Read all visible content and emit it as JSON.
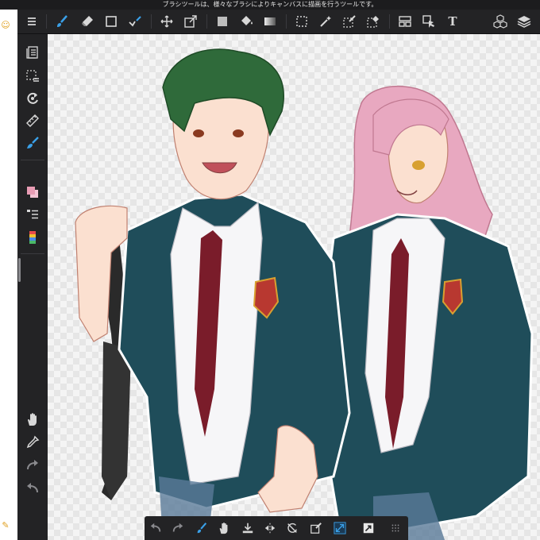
{
  "tooltip": {
    "text": "ブラシツールは、様々なブラシによりキャンバスに描画を行うツールです。"
  },
  "colors": {
    "toolbar_bg": "#232325",
    "icon": "#d8d8d8",
    "accent": "#3aa0e8",
    "canvas_checker": "#e6e6e6"
  },
  "top_toolbar": {
    "items": [
      {
        "icon": "menu-icon"
      },
      {
        "icon": "brush-icon",
        "active": true
      },
      {
        "icon": "eraser-icon"
      },
      {
        "icon": "shape-rectangle-icon"
      },
      {
        "icon": "pen-tool-icon"
      },
      {
        "icon": "move-icon"
      },
      {
        "icon": "transform-icon"
      },
      {
        "icon": "fill-rect-icon"
      },
      {
        "icon": "bucket-fill-icon"
      },
      {
        "icon": "gradient-icon"
      },
      {
        "icon": "rect-select-icon"
      },
      {
        "icon": "magic-wand-icon"
      },
      {
        "icon": "select-pen-icon"
      },
      {
        "icon": "select-eraser-icon"
      },
      {
        "icon": "frame-icon"
      },
      {
        "icon": "operation-icon"
      },
      {
        "icon": "text-icon"
      },
      {
        "icon": "materials-icon"
      },
      {
        "icon": "layers-icon"
      }
    ],
    "text_tool_glyph": "T"
  },
  "left_toolbar": {
    "items": [
      {
        "icon": "brush-window-icon"
      },
      {
        "icon": "selection-menu-icon"
      },
      {
        "icon": "rotate-icon"
      },
      {
        "icon": "ruler-icon"
      },
      {
        "icon": "brush-settings-icon"
      },
      {
        "icon": "color-icon"
      },
      {
        "icon": "layer-list-icon"
      },
      {
        "icon": "palette-icon"
      },
      {
        "icon": "hand-icon"
      },
      {
        "icon": "eyedropper-icon"
      },
      {
        "icon": "redo-icon"
      },
      {
        "icon": "undo-icon"
      }
    ]
  },
  "bottom_toolbar": {
    "items": [
      {
        "icon": "undo-icon"
      },
      {
        "icon": "redo-icon"
      },
      {
        "icon": "brush-mini-icon"
      },
      {
        "icon": "hand-icon"
      },
      {
        "icon": "save-icon"
      },
      {
        "icon": "flip-icon"
      },
      {
        "icon": "rotate-reset-icon"
      },
      {
        "icon": "fill-icon"
      },
      {
        "icon": "fit-screen-icon",
        "active": true
      },
      {
        "icon": "snap-icon"
      },
      {
        "icon": "grid-dots-icon"
      }
    ]
  },
  "edge_icons": {
    "top": "smile-icon",
    "bottom": "edit-icon"
  }
}
